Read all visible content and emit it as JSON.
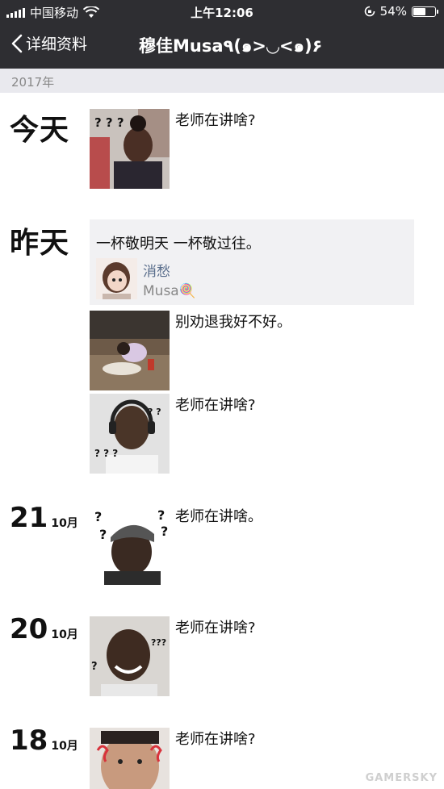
{
  "status": {
    "carrier": "中国移动",
    "time": "上午12:06",
    "battery": "54%",
    "battery_level": 0.54
  },
  "nav": {
    "back_label": "详细资料",
    "title": "穆佳Musa٩(๑>◡<๑)۶"
  },
  "year": "2017年",
  "days": {
    "today": "今天",
    "yesterday": "昨天",
    "d21": {
      "num": "21",
      "month": "10月"
    },
    "d20": {
      "num": "20",
      "month": "10月"
    },
    "d18": {
      "num": "18",
      "month": "10月"
    }
  },
  "posts": {
    "today1": "老师在讲啥?",
    "share": {
      "text": "一杯敬明天 一杯敬过往。",
      "title": "消愁",
      "artist": "Musa🍭"
    },
    "yest2": "别劝退我好不好。",
    "yest3": "老师在讲啥?",
    "d21": "老师在讲啥。",
    "d20": "老师在讲啥?",
    "d18": "老师在讲啥?"
  },
  "watermark": "GAMERSKY"
}
